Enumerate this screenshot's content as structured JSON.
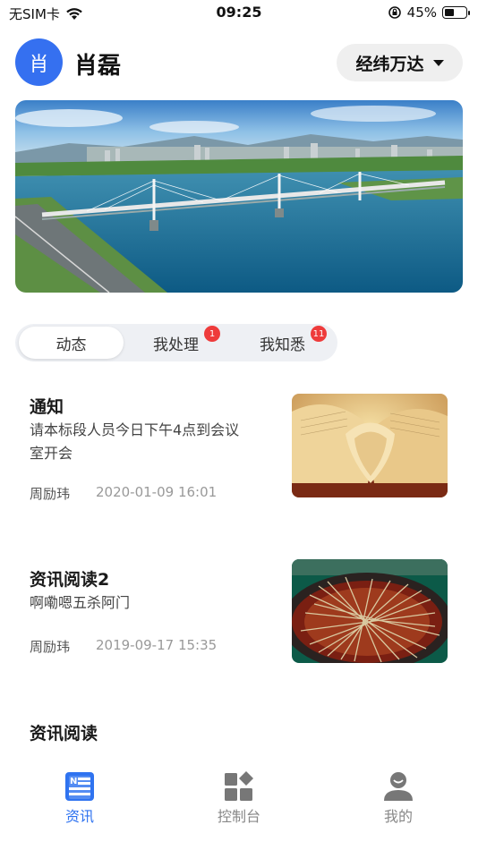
{
  "status_bar": {
    "carrier": "无SIM卡",
    "time": "09:25",
    "battery": "45%",
    "battery_level": 0.45
  },
  "header": {
    "avatar_text": "肖",
    "user_name": "肖磊",
    "project": "经纬万达"
  },
  "tabs": [
    {
      "label": "动态"
    },
    {
      "label": "我处理",
      "badge": "1"
    },
    {
      "label": "我知悉",
      "badge": "11"
    }
  ],
  "news": [
    {
      "title": "通知",
      "summary": "请本标段人员今日下午4点到会议室开会",
      "author": "周励玮",
      "date": "2020-01-09 16:01"
    },
    {
      "title": "资讯阅读2",
      "summary": "啊嘞嗯五杀阿门",
      "author": "周励玮",
      "date": "2019-09-17 15:35"
    },
    {
      "title": "资讯阅读"
    }
  ],
  "bottom_nav": [
    {
      "label": "资讯",
      "icon": "news-icon"
    },
    {
      "label": "控制台",
      "icon": "dashboard-icon"
    },
    {
      "label": "我的",
      "icon": "profile-icon"
    }
  ],
  "colors": {
    "accent": "#2f73f0",
    "badge": "#ee3b3b"
  }
}
